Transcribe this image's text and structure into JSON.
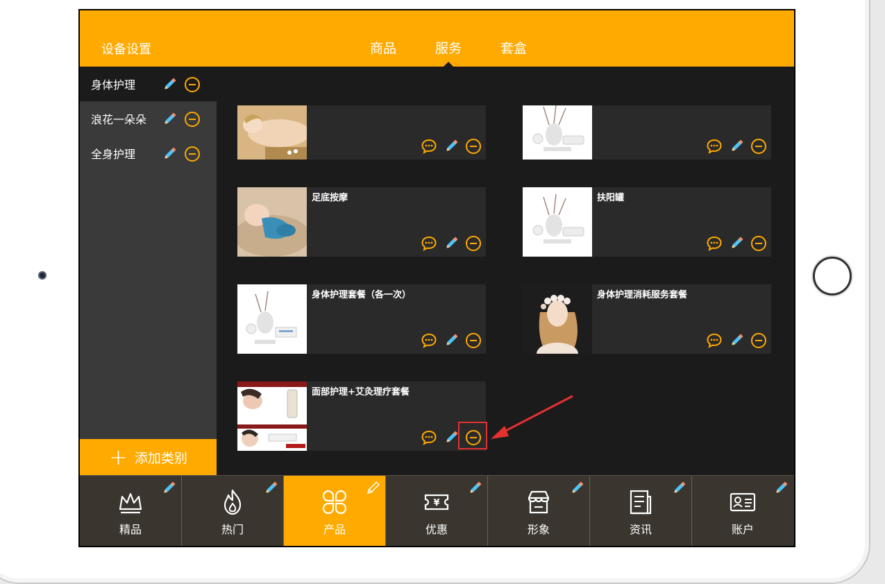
{
  "header": {
    "device_settings": "设备设置",
    "tabs": [
      {
        "label": "商品",
        "active": false
      },
      {
        "label": "服务",
        "active": true
      },
      {
        "label": "套盒",
        "active": false
      }
    ]
  },
  "sidebar": {
    "categories": [
      {
        "label": "身体护理",
        "active": true
      },
      {
        "label": "浪花一朵朵",
        "active": false
      },
      {
        "label": "全身护理",
        "active": false
      }
    ],
    "add_category": "添加类别"
  },
  "products": [
    {
      "title": "",
      "image": "massage-photo"
    },
    {
      "title": "",
      "image": "cosmetics-photo"
    },
    {
      "title": "足底按摩",
      "image": "baby-photo"
    },
    {
      "title": "扶阳罐",
      "image": "cosmetics-photo"
    },
    {
      "title": "身体护理套餐（各一次）",
      "image": "cosmetics-photo"
    },
    {
      "title": "身体护理消耗服务套餐",
      "image": "woman-flowers-photo"
    },
    {
      "title": "面部护理+艾灸理疗套餐",
      "image": "skincare-ad-photo"
    }
  ],
  "bottom_nav": [
    {
      "label": "精品",
      "icon": "crown-icon",
      "active": false
    },
    {
      "label": "热门",
      "icon": "flame-icon",
      "active": false
    },
    {
      "label": "产品",
      "icon": "grid-icon",
      "active": true
    },
    {
      "label": "优惠",
      "icon": "coupon-icon",
      "active": false
    },
    {
      "label": "形象",
      "icon": "store-icon",
      "active": false
    },
    {
      "label": "资讯",
      "icon": "news-icon",
      "active": false
    },
    {
      "label": "账户",
      "icon": "id-card-icon",
      "active": false
    }
  ],
  "colors": {
    "accent": "#ffaa00",
    "background": "#1b1b1b",
    "sidebar": "#3a3a3a",
    "card": "#2a2a2a",
    "highlight": "#e53030"
  }
}
